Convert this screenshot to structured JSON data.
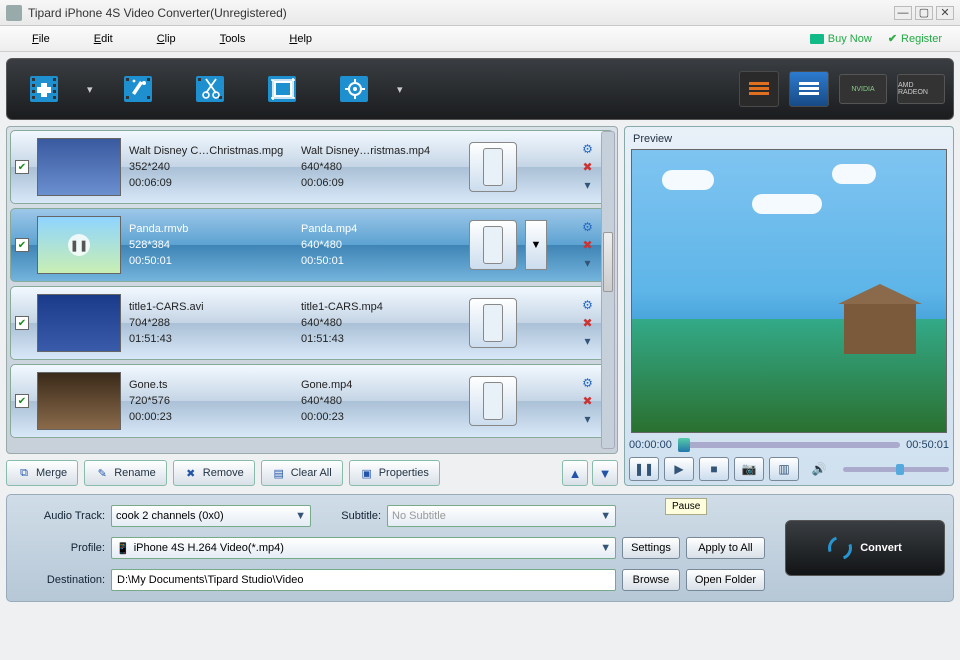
{
  "window": {
    "title": "Tipard iPhone 4S Video Converter(Unregistered)"
  },
  "menu": {
    "file": "File",
    "edit": "Edit",
    "clip": "Clip",
    "tools": "Tools",
    "help": "Help",
    "buy": "Buy Now",
    "register": "Register"
  },
  "toolbar": {
    "add": "add-file",
    "effect": "effect",
    "trim": "trim",
    "crop": "crop",
    "settings": "settings",
    "view_list": "list-view",
    "view_detail": "detail-view",
    "nvidia": "NVIDIA",
    "amd": "AMD RADEON"
  },
  "list": {
    "rows": [
      {
        "checked": true,
        "src_name": "Walt Disney C…Christmas.mpg",
        "src_res": "352*240",
        "src_dur": "00:06:09",
        "out_name": "Walt Disney…ristmas.mp4",
        "out_res": "640*480",
        "out_dur": "00:06:09",
        "selected": false
      },
      {
        "checked": true,
        "src_name": "Panda.rmvb",
        "src_res": "528*384",
        "src_dur": "00:50:01",
        "out_name": "Panda.mp4",
        "out_res": "640*480",
        "out_dur": "00:50:01",
        "selected": true
      },
      {
        "checked": true,
        "src_name": "title1-CARS.avi",
        "src_res": "704*288",
        "src_dur": "01:51:43",
        "out_name": "title1-CARS.mp4",
        "out_res": "640*480",
        "out_dur": "01:51:43",
        "selected": false
      },
      {
        "checked": true,
        "src_name": "Gone.ts",
        "src_res": "720*576",
        "src_dur": "00:00:23",
        "out_name": "Gone.mp4",
        "out_res": "640*480",
        "out_dur": "00:00:23",
        "selected": false
      }
    ],
    "buttons": {
      "merge": "Merge",
      "rename": "Rename",
      "remove": "Remove",
      "clear": "Clear All",
      "props": "Properties"
    }
  },
  "preview": {
    "label": "Preview",
    "time_cur": "00:00:00",
    "time_end": "00:50:01",
    "tooltip": "Pause"
  },
  "settings": {
    "audio_label": "Audio Track:",
    "audio_value": "cook 2 channels (0x0)",
    "subtitle_label": "Subtitle:",
    "subtitle_value": "No Subtitle",
    "profile_label": "Profile:",
    "profile_value": "iPhone 4S H.264 Video(*.mp4)",
    "dest_label": "Destination:",
    "dest_value": "D:\\My Documents\\Tipard Studio\\Video",
    "settings_btn": "Settings",
    "apply_btn": "Apply to All",
    "browse_btn": "Browse",
    "open_btn": "Open Folder"
  },
  "convert": {
    "label": "Convert"
  }
}
